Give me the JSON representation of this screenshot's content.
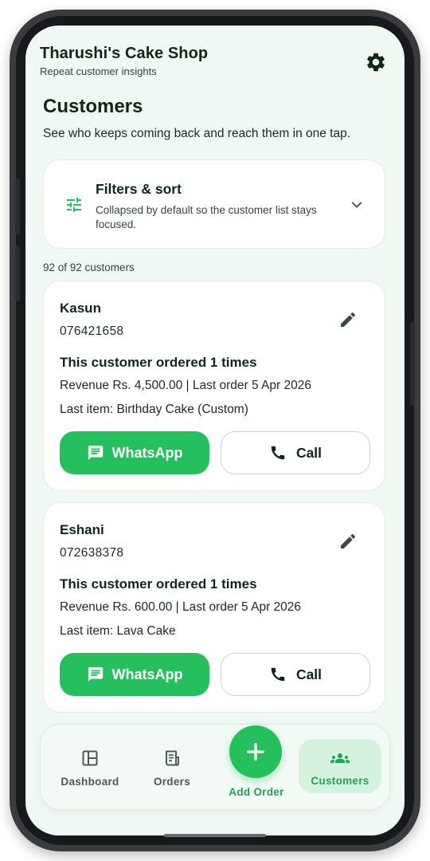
{
  "app": {
    "title": "Tharushi's Cake Shop",
    "subtitle": "Repeat customer insights"
  },
  "page": {
    "title": "Customers",
    "description": "See who keeps coming back and reach them in one tap."
  },
  "filters": {
    "title": "Filters & sort",
    "description": "Collapsed by default so the customer list stays focused.",
    "expanded": false
  },
  "customer_count": "92 of 92 customers",
  "customers": [
    {
      "name": "Kasun",
      "phone": "076421658",
      "orders_text": "This customer ordered 1 times",
      "revenue_text": "Revenue Rs. 4,500.00 | Last order 5 Apr 2026",
      "last_item_text": "Last item: Birthday Cake (Custom)",
      "whatsapp_label": "WhatsApp",
      "call_label": "Call"
    },
    {
      "name": "Eshani",
      "phone": "072638378",
      "orders_text": "This customer ordered 1 times",
      "revenue_text": "Revenue Rs. 600.00 | Last order 5 Apr 2026",
      "last_item_text": "Last item: Lava Cake",
      "whatsapp_label": "WhatsApp",
      "call_label": "Call"
    }
  ],
  "nav": {
    "items": [
      {
        "label": "Dashboard",
        "icon": "dashboard-icon",
        "active": false
      },
      {
        "label": "Orders",
        "icon": "receipt-icon",
        "active": false
      },
      {
        "label": "Add Order",
        "icon": "plus-icon",
        "active": false
      },
      {
        "label": "Customers",
        "icon": "group-icon",
        "active": true
      }
    ]
  },
  "colors": {
    "accent": "#25c05d",
    "accent_text": "#1ea452",
    "background": "#eff8f2",
    "active_pill": "#d4f2de",
    "title_text": "#10261b"
  }
}
